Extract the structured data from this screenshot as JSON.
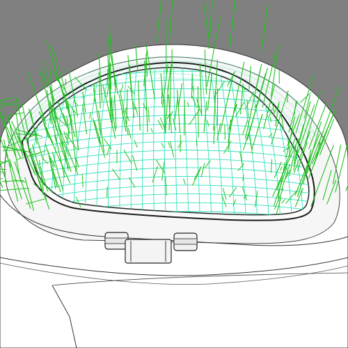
{
  "viewport": {
    "background_color": "#808080",
    "body_color": "#ffffff",
    "edge_color": "#222222",
    "isocurve_color": "#2ee0b8",
    "normal_vector_color": "#1fc01f",
    "normal_vectors_visible": true,
    "isocurves_visible": true,
    "display_mode": "shaded"
  },
  "objects": [
    {
      "name": "trunk-lid-surface",
      "type": "surface"
    },
    {
      "name": "window-opening-outline",
      "type": "curve"
    },
    {
      "name": "hinge",
      "type": "part"
    },
    {
      "name": "car-body-panel",
      "type": "surface"
    }
  ]
}
